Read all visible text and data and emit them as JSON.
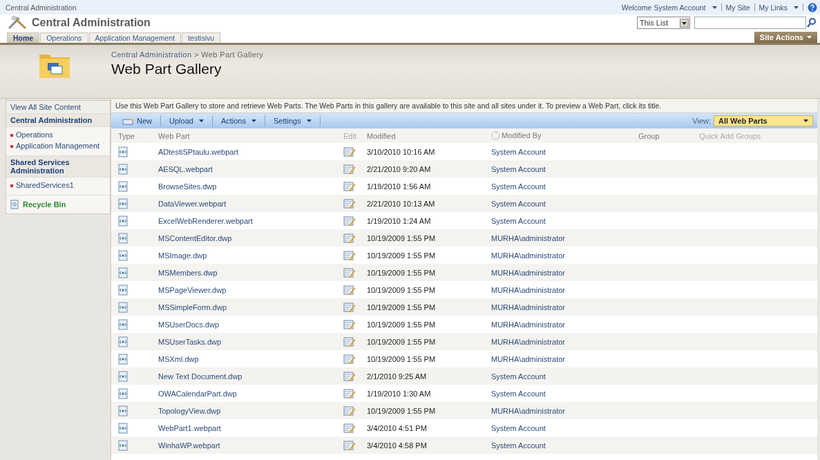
{
  "top_bar": {
    "site": "Central Administration",
    "welcome": "Welcome System Account",
    "links": [
      "My Site",
      "My Links"
    ]
  },
  "header": {
    "title": "Central Administration",
    "scope": "This List"
  },
  "tabs": [
    {
      "label": "Home",
      "selected": true
    },
    {
      "label": "Operations",
      "selected": false
    },
    {
      "label": "Application Management",
      "selected": false
    },
    {
      "label": "testisivu",
      "selected": false
    }
  ],
  "site_actions": "Site Actions",
  "breadcrumb": [
    "Central Administration",
    "Web Part Gallery"
  ],
  "breadcrumb_separator": ">",
  "page_title": "Web Part Gallery",
  "sidebar": {
    "view_all": "View All Site Content",
    "sections": [
      {
        "heading": "Central Administration",
        "items": [
          "Operations",
          "Application Management"
        ]
      },
      {
        "heading": "Shared Services Administration",
        "items": [
          "SharedServices1"
        ]
      }
    ],
    "recycle_bin": "Recycle Bin"
  },
  "description": "Use this Web Part Gallery to store and retrieve Web Parts. The Web Parts in this gallery are available to this site and all sites under it. To preview a Web Part, click its title.",
  "toolbar": {
    "buttons": [
      {
        "label": "New",
        "kind": "new"
      },
      {
        "label": "Upload",
        "kind": "menu"
      },
      {
        "label": "Actions",
        "kind": "menu"
      },
      {
        "label": "Settings",
        "kind": "menu"
      }
    ],
    "view_label": "View:",
    "view": "All Web Parts"
  },
  "table": {
    "columns": [
      "Type",
      "Web Part",
      "Edit",
      "Modified",
      "Modified By",
      "Group",
      "Quick Add Groups"
    ],
    "rows": [
      {
        "name": "ADtestiSPtaulu.webpart",
        "modified": "3/10/2010 10:16 AM",
        "modified_by": "System Account"
      },
      {
        "name": "AESQL.webpart",
        "modified": "2/21/2010 9:20 AM",
        "modified_by": "System Account"
      },
      {
        "name": "BrowseSites.dwp",
        "modified": "1/19/2010 1:56 AM",
        "modified_by": "System Account"
      },
      {
        "name": "DataViewer.webpart",
        "modified": "2/21/2010 10:13 AM",
        "modified_by": "System Account"
      },
      {
        "name": "ExcelWebRenderer.webpart",
        "modified": "1/19/2010 1:24 AM",
        "modified_by": "System Account"
      },
      {
        "name": "MSContentEditor.dwp",
        "modified": "10/19/2009 1:55 PM",
        "modified_by": "MURHA\\administrator"
      },
      {
        "name": "MSImage.dwp",
        "modified": "10/19/2009 1:55 PM",
        "modified_by": "MURHA\\administrator"
      },
      {
        "name": "MSMembers.dwp",
        "modified": "10/19/2009 1:55 PM",
        "modified_by": "MURHA\\administrator"
      },
      {
        "name": "MSPageViewer.dwp",
        "modified": "10/19/2009 1:55 PM",
        "modified_by": "MURHA\\administrator"
      },
      {
        "name": "MSSimpleForm.dwp",
        "modified": "10/19/2009 1:55 PM",
        "modified_by": "MURHA\\administrator"
      },
      {
        "name": "MSUserDocs.dwp",
        "modified": "10/19/2009 1:55 PM",
        "modified_by": "MURHA\\administrator"
      },
      {
        "name": "MSUserTasks.dwp",
        "modified": "10/19/2009 1:55 PM",
        "modified_by": "MURHA\\administrator"
      },
      {
        "name": "MSXml.dwp",
        "modified": "10/19/2009 1:55 PM",
        "modified_by": "MURHA\\administrator"
      },
      {
        "name": "New Text Document.dwp",
        "modified": "2/1/2010 9:25 AM",
        "modified_by": "System Account"
      },
      {
        "name": "OWACalendarPart.dwp",
        "modified": "1/19/2010 1:30 AM",
        "modified_by": "System Account"
      },
      {
        "name": "TopologyView.dwp",
        "modified": "10/19/2009 1:55 PM",
        "modified_by": "MURHA\\administrator"
      },
      {
        "name": "WebPart1.webpart",
        "modified": "3/4/2010 4:51 PM",
        "modified_by": "System Account"
      },
      {
        "name": "WinhaWP.webpart",
        "modified": "3/4/2010 4:58 PM",
        "modified_by": "System Account"
      }
    ]
  }
}
